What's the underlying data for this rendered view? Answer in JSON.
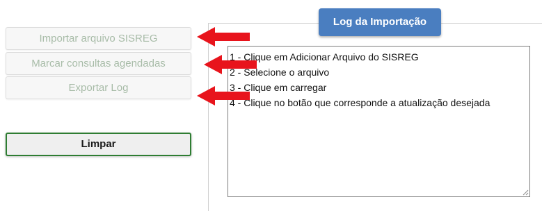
{
  "sidebar": {
    "import_label": "Importar arquivo SISREG",
    "mark_label": "Marcar consultas agendadas",
    "export_label": "Exportar Log",
    "clear_label": "Limpar"
  },
  "log": {
    "legend": "Log da Importação",
    "lines": [
      "1 - Clique em Adicionar Arquivo do SISREG",
      "2 - Selecione o arquivo",
      "3 - Clique em carregar",
      "4 - Clique no botão que corresponde a atualização desejada"
    ]
  },
  "colors": {
    "arrow": "#e8141c",
    "legend_bg": "#4a7ec0",
    "clear_border": "#2e7d32",
    "disabled_text": "#a8bca8"
  },
  "icons": {
    "arrow": "red-arrow-icon",
    "grip": "resize-grip-icon"
  }
}
